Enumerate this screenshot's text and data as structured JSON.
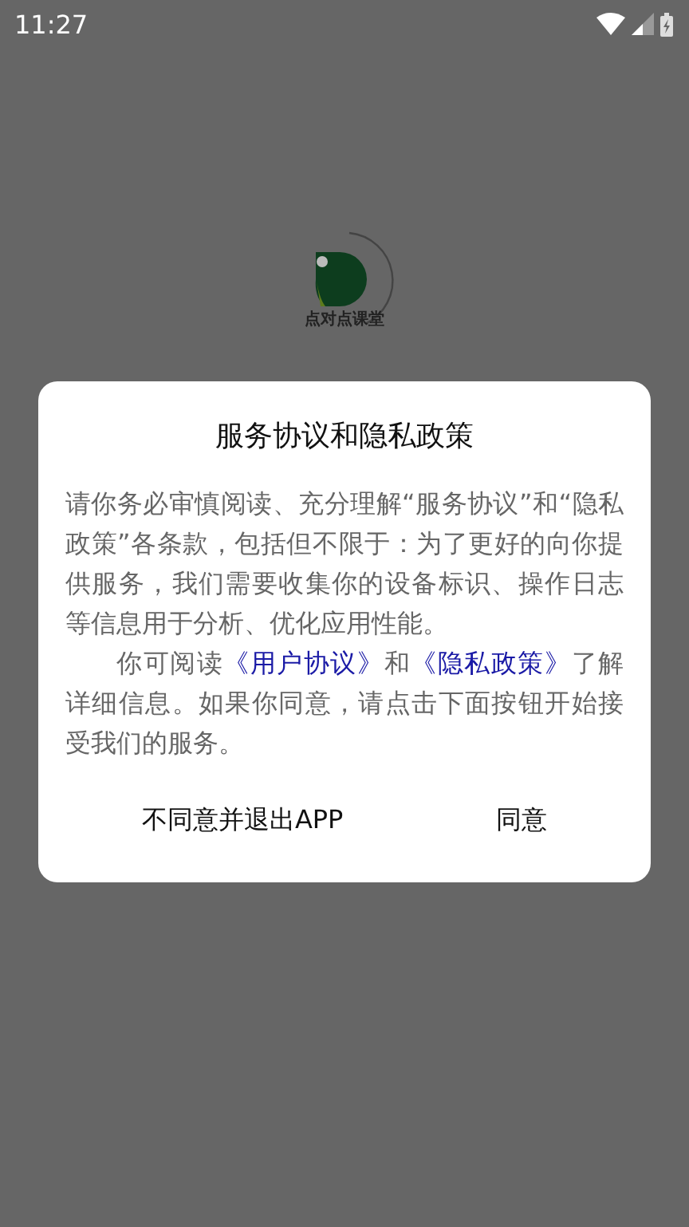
{
  "status_bar": {
    "time": "11:27"
  },
  "app_logo": {
    "text": "点对点课堂"
  },
  "dialog": {
    "title": "服务协议和隐私政策",
    "paragraphs": [
      {
        "parts": [
          {
            "kind": "text",
            "text": "请你务必审慎阅读、充分理解“服务协议”和“隐私政策”各条款，包括但不限于：为了更好的向你提供服务，我们需要收集你的设备标识、操作日志等信息用于分析、优化应用性能。"
          }
        ]
      },
      {
        "parts": [
          {
            "kind": "text",
            "text": "你可阅读"
          },
          {
            "kind": "link",
            "text": "《用户协议》"
          },
          {
            "kind": "text",
            "text": "和"
          },
          {
            "kind": "link",
            "text": "《隐私政策》"
          },
          {
            "kind": "text",
            "text": "了解详细信息。如果你同意，请点击下面按钮开始接受我们的服务。"
          }
        ]
      }
    ],
    "buttons": [
      "不同意并退出APP",
      "同意"
    ]
  }
}
